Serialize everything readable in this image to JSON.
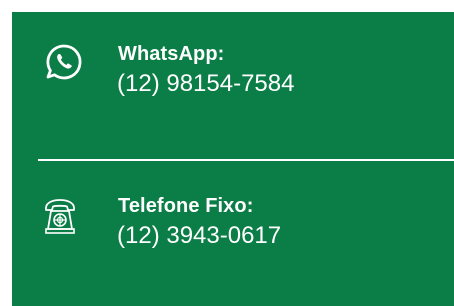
{
  "contacts": [
    {
      "icon": "whatsapp-icon",
      "label": "WhatsApp:",
      "number": "(12) 98154-7584"
    },
    {
      "icon": "telephone-icon",
      "label": "Telefone Fixo:",
      "number": "(12) 3943-0617"
    }
  ],
  "colors": {
    "background": "#0b7d46",
    "text": "#ffffff",
    "page": "#ffffff"
  }
}
